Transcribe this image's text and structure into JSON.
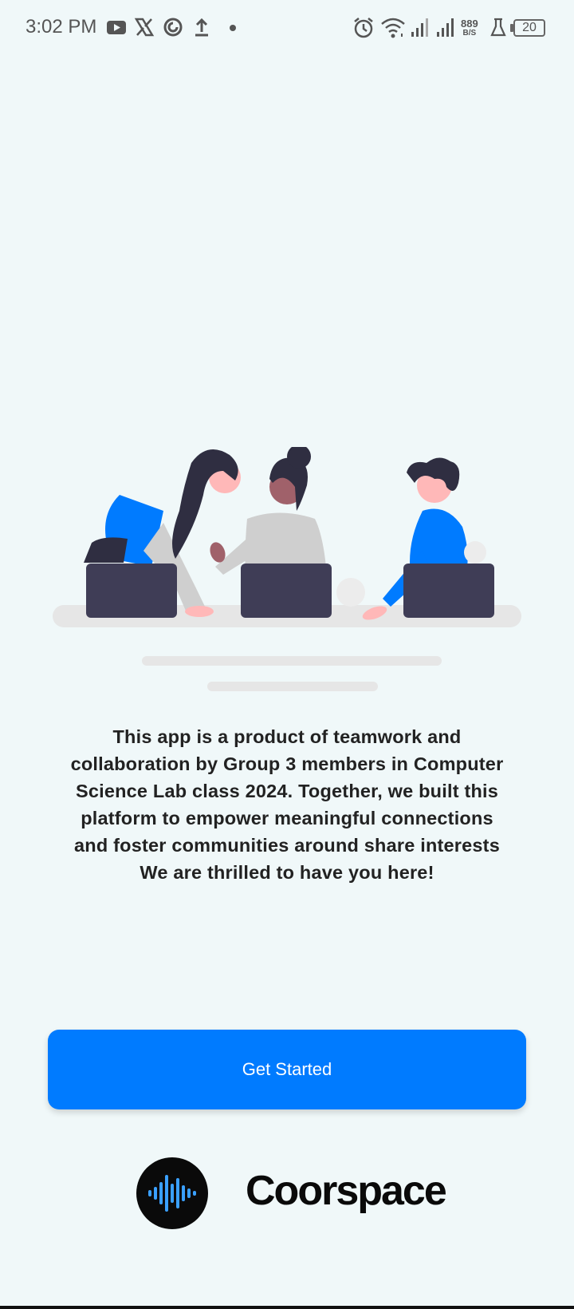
{
  "status_bar": {
    "time": "3:02 PM",
    "net_speed_value": "889",
    "net_speed_unit": "B/S",
    "battery": "20",
    "icons": [
      "youtube-icon",
      "x-icon",
      "app-icon",
      "upload-icon",
      "dot-icon",
      "alarm-icon",
      "wifi-icon",
      "signal-icon",
      "signal-icon",
      "lab-icon",
      "battery-icon"
    ]
  },
  "about": {
    "lines": [
      "This app is a product of teamwork and",
      "collaboration by Group 3 members in Computer",
      "Science Lab class 2024. Together, we built this",
      "platform to empower meaningful connections",
      "and foster communities around share interests",
      "We are thrilled to have you here!"
    ]
  },
  "cta": {
    "label": "Get Started"
  },
  "brand": {
    "name": "Coorspace"
  },
  "colors": {
    "background": "#f0f8f9",
    "accent": "#007bff",
    "laptop": "#3f3d56"
  }
}
